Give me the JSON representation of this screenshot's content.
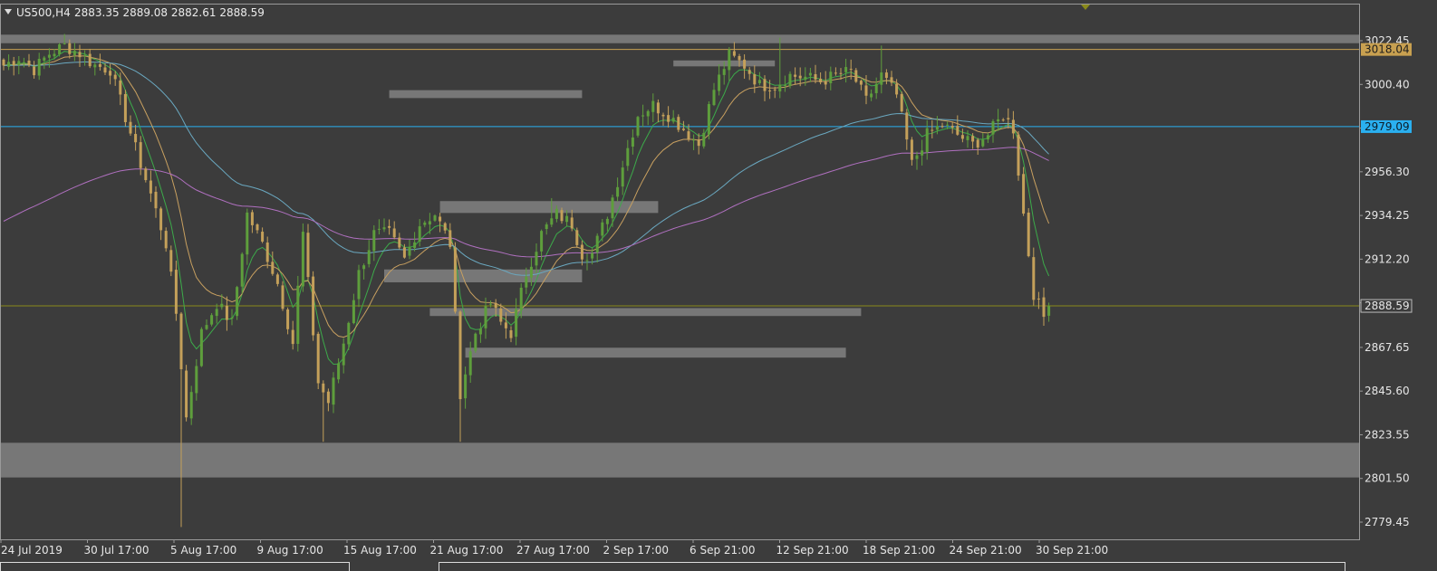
{
  "header": {
    "symbol": "US500,H4",
    "ohlc": "2883.35 2889.08 2882.61 2888.59"
  },
  "colors": {
    "background": "#3c3c3c",
    "frame": "#9a9a9a",
    "bull_candle": "#5e9e3c",
    "bear_candle": "#c4a05a",
    "zone": "#7a7a7a",
    "resistance": "#c8a050",
    "blue_level": "#2ab0f0",
    "bid_line": "#8a8a1a",
    "ma_fast": "#3caa4a",
    "ma_mid": "#c8a060",
    "ma_slow": "#6aa8c0",
    "ma_long": "#b070c0"
  },
  "chart_data": {
    "type": "candlestick",
    "y_ticks": [
      3022.45,
      3000.4,
      2978.35,
      2956.3,
      2934.25,
      2912.2,
      2890.15,
      2867.65,
      2845.6,
      2823.55,
      2801.5,
      2779.45
    ],
    "y_tick_labels": [
      "3022.45",
      "3000.40",
      "",
      "2956.30",
      "2934.25",
      "2912.20",
      "",
      "2867.65",
      "2845.60",
      "2823.55",
      "2801.50",
      "2779.45"
    ],
    "x_labels": [
      "24 Jul 2019",
      "30 Jul 17:00",
      "5 Aug 17:00",
      "9 Aug 17:00",
      "15 Aug 17:00",
      "21 Aug 17:00",
      "27 Aug 17:00",
      "2 Sep 17:00",
      "6 Sep 21:00",
      "12 Sep 21:00",
      "18 Sep 21:00",
      "24 Sep 21:00",
      "30 Sep 21:00"
    ],
    "price_tags": [
      {
        "price": 3018.04,
        "label": "3018.04",
        "kind": "resistance"
      },
      {
        "price": 2979.09,
        "label": "2979.09",
        "kind": "blue_level"
      },
      {
        "price": 2888.59,
        "label": "2888.59",
        "kind": "bid"
      }
    ],
    "zones": [
      {
        "start_bar": 0,
        "end_bar": 255,
        "low": 3021.2,
        "high": 3025.5
      },
      {
        "start_bar": 0,
        "end_bar": 255,
        "low": 2802.0,
        "high": 2819.5
      },
      {
        "start_bar": 132,
        "end_bar": 152,
        "low": 3009.5,
        "high": 3012.5
      },
      {
        "start_bar": 76,
        "end_bar": 114,
        "low": 2993.5,
        "high": 2997.5
      },
      {
        "start_bar": 86,
        "end_bar": 129,
        "low": 2935.5,
        "high": 2941.5
      },
      {
        "start_bar": 75,
        "end_bar": 114,
        "low": 2900.5,
        "high": 2907.0
      },
      {
        "start_bar": 84,
        "end_bar": 169,
        "low": 2883.5,
        "high": 2887.5
      },
      {
        "start_bar": 91,
        "end_bar": 166,
        "low": 2862.5,
        "high": 2867.5
      }
    ],
    "series_anchors": [
      [
        0,
        3010
      ],
      [
        3,
        3014
      ],
      [
        6,
        3008
      ],
      [
        9,
        3016
      ],
      [
        12,
        3020
      ],
      [
        15,
        3016
      ],
      [
        18,
        3010
      ],
      [
        21,
        3008
      ],
      [
        23,
        2992
      ],
      [
        26,
        2968
      ],
      [
        29,
        2945
      ],
      [
        32,
        2920
      ],
      [
        34,
        2885
      ],
      [
        36,
        2832
      ],
      [
        39,
        2875
      ],
      [
        42,
        2890
      ],
      [
        45,
        2880
      ],
      [
        48,
        2935
      ],
      [
        51,
        2920
      ],
      [
        54,
        2900
      ],
      [
        57,
        2870
      ],
      [
        59,
        2925
      ],
      [
        62,
        2850
      ],
      [
        64,
        2840
      ],
      [
        67,
        2870
      ],
      [
        70,
        2905
      ],
      [
        73,
        2925
      ],
      [
        76,
        2925
      ],
      [
        79,
        2912
      ],
      [
        82,
        2930
      ],
      [
        85,
        2935
      ],
      [
        88,
        2920
      ],
      [
        90,
        2845
      ],
      [
        93,
        2875
      ],
      [
        96,
        2890
      ],
      [
        98,
        2880
      ],
      [
        100,
        2875
      ],
      [
        103,
        2905
      ],
      [
        106,
        2925
      ],
      [
        109,
        2935
      ],
      [
        112,
        2930
      ],
      [
        114,
        2915
      ],
      [
        116,
        2915
      ],
      [
        119,
        2935
      ],
      [
        122,
        2960
      ],
      [
        125,
        2985
      ],
      [
        128,
        2990
      ],
      [
        131,
        2985
      ],
      [
        134,
        2978
      ],
      [
        137,
        2970
      ],
      [
        140,
        2998
      ],
      [
        143,
        3015
      ],
      [
        146,
        3010
      ],
      [
        149,
        3000
      ],
      [
        152,
        3000
      ],
      [
        155,
        3005
      ],
      [
        158,
        3004
      ],
      [
        161,
        3002
      ],
      [
        164,
        3005
      ],
      [
        167,
        3007
      ],
      [
        170,
        2992
      ],
      [
        173,
        3005
      ],
      [
        176,
        2995
      ],
      [
        179,
        2960
      ],
      [
        182,
        2975
      ],
      [
        185,
        2980
      ],
      [
        188,
        2975
      ],
      [
        191,
        2970
      ],
      [
        194,
        2975
      ],
      [
        197,
        2985
      ],
      [
        199,
        2978
      ],
      [
        201,
        2935
      ],
      [
        203,
        2895
      ],
      [
        205,
        2883
      ],
      [
        206,
        2888
      ]
    ],
    "moving_averages": [
      {
        "key": "ma_fast",
        "period": 6
      },
      {
        "key": "ma_mid",
        "period": 14
      },
      {
        "key": "ma_slow",
        "period": 60
      },
      {
        "key": "ma_long",
        "period": 120,
        "seed": 2930
      }
    ],
    "price_range": [
      2775,
      3040
    ]
  }
}
